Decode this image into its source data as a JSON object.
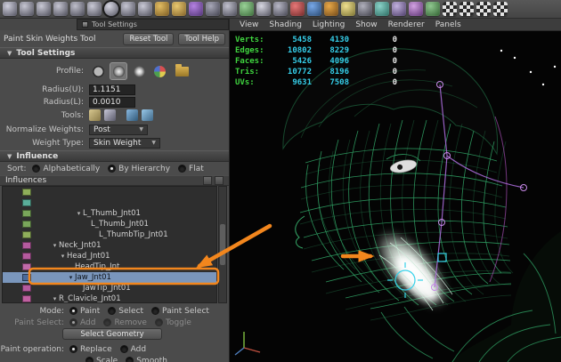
{
  "shelf": {
    "icons": [
      {
        "name": "poly-sphere",
        "c1": "#cfcfdc",
        "c2": "#4f4f5c"
      },
      {
        "name": "poly-cube",
        "c1": "#c6c6d2",
        "c2": "#4a4a56"
      },
      {
        "name": "poly-cylinder",
        "c1": "#c9c9d5",
        "c2": "#4c4c58"
      },
      {
        "name": "poly-cone",
        "c1": "#c6c6d2",
        "c2": "#484854"
      },
      {
        "name": "poly-plane",
        "c1": "#bfbfcb",
        "c2": "#454551"
      },
      {
        "name": "poly-torus",
        "c1": "#c9c9d5",
        "c2": "#4c4c58"
      },
      {
        "name": "poly-prism",
        "c1": "#d6d6e2",
        "c2": "#50505c",
        "hl": true
      },
      {
        "name": "poly-pyramid",
        "c1": "#c6c6d2",
        "c2": "#4a4a56"
      },
      {
        "name": "poly-pipe",
        "c1": "#c9c9d5",
        "c2": "#4c4c58"
      },
      {
        "name": "poly-helix",
        "c1": "#e2bd62",
        "c2": "#7a5a22"
      },
      {
        "name": "poly-soccerball",
        "c1": "#e8c870",
        "c2": "#806028"
      },
      {
        "name": "nurbs-sphere",
        "c1": "#b582e2",
        "c2": "#4e3272"
      },
      {
        "name": "nurbs-cube",
        "c1": "#a8a8b8",
        "c2": "#3f3f4c"
      },
      {
        "name": "nurbs-circle",
        "c1": "#c2c2ce",
        "c2": "#474753"
      },
      {
        "name": "bevel-plus",
        "c1": "#9ad298",
        "c2": "#3a6a38"
      },
      {
        "name": "text-tool",
        "c1": "#d8d8e2",
        "c2": "#52525e"
      },
      {
        "name": "subdiv-sphere",
        "c1": "#b8b8c6",
        "c2": "#43434f"
      },
      {
        "name": "lambert-sphere",
        "c1": "#e87878",
        "c2": "#702828"
      },
      {
        "name": "blinn-sphere",
        "c1": "#78a8e8",
        "c2": "#284870"
      },
      {
        "name": "ramp-texture",
        "c1": "#e8a848",
        "c2": "#704818"
      },
      {
        "name": "light",
        "c1": "#f0e090",
        "c2": "#787030"
      },
      {
        "name": "camera",
        "c1": "#b0b0bc",
        "c2": "#40404a"
      },
      {
        "name": "joint-tool",
        "c1": "#8ad2c8",
        "c2": "#2a6a60"
      },
      {
        "name": "ik-handle",
        "c1": "#c2b2de",
        "c2": "#4a3a66"
      },
      {
        "name": "paint-weights",
        "c1": "#d2a2e2",
        "c2": "#5a3070"
      },
      {
        "name": "file-texture",
        "c1": "#90c890",
        "c2": "#306030"
      },
      {
        "name": "checker-map-1",
        "checker": true
      },
      {
        "name": "checker-map-2",
        "checker": true
      },
      {
        "name": "checker-map-3",
        "checker": true
      },
      {
        "name": "checker-map-4",
        "checker": true
      }
    ]
  },
  "left_panel": {
    "title": "Tool Settings",
    "tool_name": "Paint Skin Weights Tool",
    "reset_button": "Reset Tool",
    "help_button": "Tool Help",
    "tool_settings_section": {
      "header": "Tool Settings",
      "profile_label": "Profile:",
      "radius_u_label": "Radius(U):",
      "radius_u_value": "1.1151",
      "radius_l_label": "Radius(L):",
      "radius_l_value": "0.0010",
      "tools_label": "Tools:",
      "normalize_label": "Normalize Weights:",
      "normalize_value": "Post",
      "weight_type_label": "Weight Type:",
      "weight_type_value": "Skin Weight"
    },
    "influence_section": {
      "header": "Influence",
      "sort_label": "Sort:",
      "sort_options": [
        {
          "label": "Alphabetically",
          "selected": false
        },
        {
          "label": "By Hierarchy",
          "selected": true
        },
        {
          "label": "Flat",
          "selected": false
        }
      ],
      "influences_label": "Influences",
      "tree": [
        {
          "label": "",
          "swatch": "#8fae5a",
          "indent": 4,
          "expander": ""
        },
        {
          "label": "",
          "swatch": "#5aae9a",
          "indent": 4,
          "expander": ""
        },
        {
          "label": "L_Thumb_Jnt01",
          "swatch": "#79a65a",
          "indent": 5,
          "expander": "▾"
        },
        {
          "label": "L_Thumb_Jnt01",
          "swatch": "#79a65a",
          "indent": 6,
          "expander": ""
        },
        {
          "label": "L_ThumbTip_Jnt01",
          "swatch": "#8fae5a",
          "indent": 7,
          "expander": ""
        },
        {
          "label": "Neck_Jnt01",
          "swatch": "#b55a9e",
          "indent": 2,
          "expander": "▾"
        },
        {
          "label": "Head_Jnt01",
          "swatch": "#b55a9e",
          "indent": 3,
          "expander": "▾"
        },
        {
          "label": "HeadTip_Jnt",
          "swatch": "#c06aa8",
          "indent": 4,
          "expander": ""
        },
        {
          "label": "Jaw_Jnt01",
          "swatch": "#4a6a9a",
          "indent": 4,
          "expander": "▾",
          "selected": true
        },
        {
          "label": "JawTip_Jnt01",
          "swatch": "#b55a9e",
          "indent": 5,
          "expander": ""
        },
        {
          "label": "R_Clavicle_Jnt01",
          "swatch": "#c060a0",
          "indent": 2,
          "expander": "▾"
        }
      ]
    },
    "bottom": {
      "mode_label": "Mode:",
      "mode_options": [
        {
          "label": "Paint",
          "selected": true
        },
        {
          "label": "Select",
          "selected": false
        },
        {
          "label": "Paint Select",
          "selected": false
        }
      ],
      "paint_select_label": "Paint Select:",
      "paint_select_options": [
        {
          "label": "Add",
          "selected": true
        },
        {
          "label": "Remove",
          "selected": false
        },
        {
          "label": "Toggle",
          "selected": false
        }
      ],
      "select_geometry": "Select Geometry",
      "paint_operation_label": "Paint operation:",
      "paint_operation_options": [
        {
          "label": "Replace",
          "selected": true
        },
        {
          "label": "Add",
          "selected": false
        }
      ],
      "paint_operation_options2": [
        {
          "label": "Scale",
          "selected": false
        },
        {
          "label": "Smooth",
          "selected": false
        }
      ]
    }
  },
  "viewport": {
    "menus": [
      "View",
      "Shading",
      "Lighting",
      "Show",
      "Renderer",
      "Panels"
    ],
    "hud": [
      {
        "label": "Verts:",
        "v1": "5458",
        "v2": "4130",
        "v3": "0"
      },
      {
        "label": "Edges:",
        "v1": "10802",
        "v2": "8229",
        "v3": "0"
      },
      {
        "label": "Faces:",
        "v1": "5426",
        "v2": "4096",
        "v3": "0"
      },
      {
        "label": "Tris:",
        "v1": "10772",
        "v2": "8196",
        "v3": "0"
      },
      {
        "label": "UVs:",
        "v1": "9631",
        "v2": "7508",
        "v3": "0"
      }
    ],
    "colors": {
      "wire": "#2f9e62",
      "hud_label": "#3fd43f",
      "hud_val1": "#35cde8",
      "hud_val2": "#35cde8",
      "hud_val3": "#e8e8e8"
    }
  },
  "glyphs": {
    "section_collapse": "▼",
    "dropdown_arrow": "▼"
  },
  "annotations": {
    "highlight_color": "#f2861d"
  }
}
